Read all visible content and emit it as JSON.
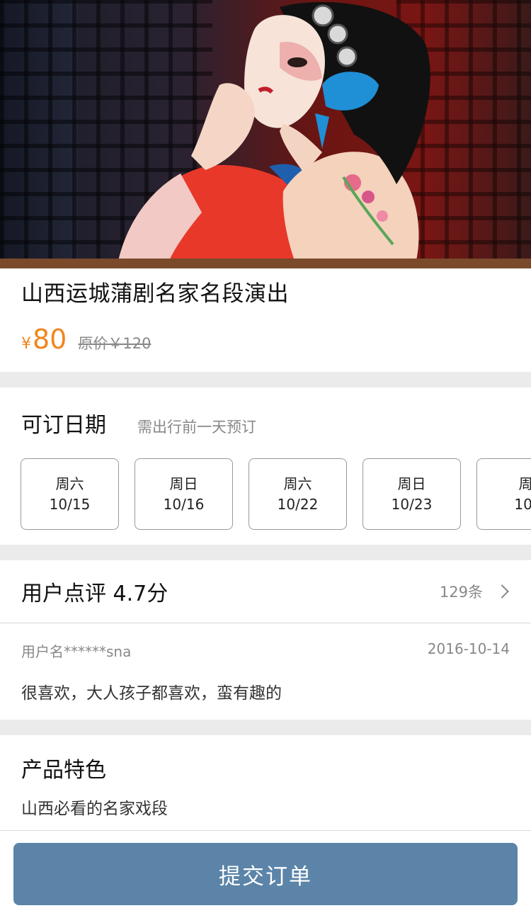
{
  "product": {
    "title": "山西运城蒲剧名家名段演出",
    "currency": "¥",
    "price": "80",
    "original_price": "原价￥120"
  },
  "dates": {
    "title": "可订日期",
    "note": "需出行前一天预订",
    "items": [
      {
        "weekday": "周六",
        "date": "10/15"
      },
      {
        "weekday": "周日",
        "date": "10/16"
      },
      {
        "weekday": "周六",
        "date": "10/22"
      },
      {
        "weekday": "周日",
        "date": "10/23"
      },
      {
        "weekday": "周",
        "date": "10/"
      }
    ]
  },
  "reviews": {
    "title": "用户点评 4.7分",
    "count": "129条",
    "item": {
      "user": "用户名******sna",
      "date": "2016-10-14",
      "text": "很喜欢，大人孩子都喜欢，蛮有趣的"
    }
  },
  "feature": {
    "title": "产品特色",
    "text": "山西必看的名家戏段"
  },
  "submit_label": "提交订单",
  "colors": {
    "accent": "#f0861f",
    "button": "#5b84a8",
    "divider": "#ebebeb"
  }
}
